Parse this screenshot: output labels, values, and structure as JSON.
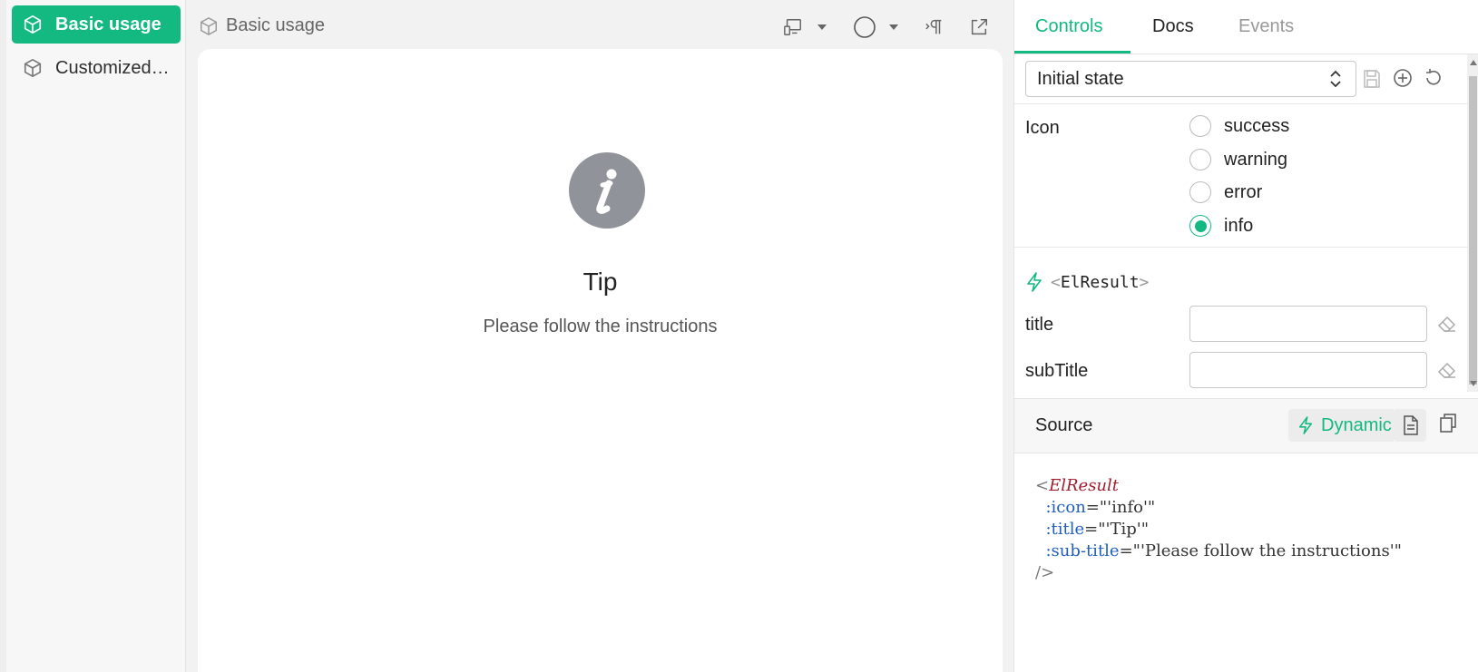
{
  "sidebar": {
    "items": [
      {
        "label": "Basic usage",
        "active": true,
        "icon": "cube-icon"
      },
      {
        "label": "Customized…",
        "active": false,
        "icon": "cube-icon"
      }
    ]
  },
  "preview": {
    "breadcrumb": "Basic usage",
    "result": {
      "icon": "info-icon",
      "icon_color": "#909399",
      "title": "Tip",
      "sub_title": "Please follow the instructions"
    }
  },
  "panel": {
    "tabs": [
      "Controls",
      "Docs",
      "Events"
    ],
    "active_tab": "Controls",
    "state_select": "Initial state",
    "icon_field": {
      "label": "Icon",
      "options": [
        "success",
        "warning",
        "error",
        "info"
      ],
      "selected": "info"
    },
    "component": {
      "open": "<",
      "name": "ElResult",
      "close": ">"
    },
    "props": [
      {
        "label": "title",
        "value": ""
      },
      {
        "label": "subTitle",
        "value": ""
      }
    ],
    "source": {
      "label": "Source",
      "mode_button": "Dynamic",
      "code": {
        "l1_open": "<",
        "l1_tag": "ElResult",
        "l2_attr": ":icon",
        "l2_val": "=\"'info'\"",
        "l3_attr": ":title",
        "l3_val": "=\"'Tip'\"",
        "l4_attr": ":sub-title",
        "l4_val": "=\"'Please follow the instructions'\"",
        "l5_close": "/>"
      }
    }
  },
  "colors": {
    "accent": "#13b981",
    "info": "#909399"
  }
}
